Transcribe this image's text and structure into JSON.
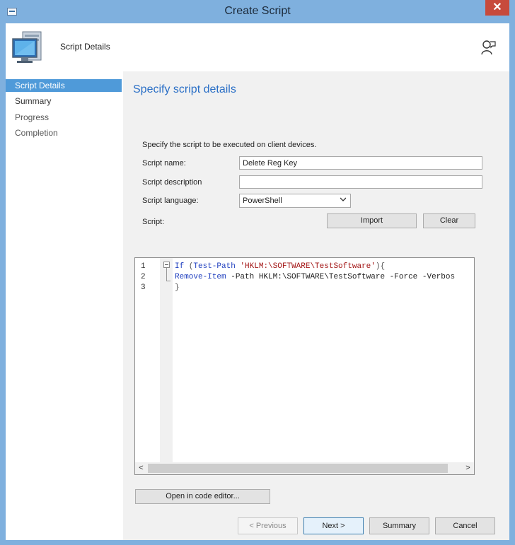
{
  "window": {
    "title": "Create Script",
    "close_label": "✕"
  },
  "header": {
    "title": "Script Details"
  },
  "nav": {
    "items": [
      {
        "label": "Script Details"
      },
      {
        "label": "Summary"
      },
      {
        "label": "Progress"
      },
      {
        "label": "Completion"
      }
    ]
  },
  "main": {
    "heading": "Specify script details",
    "instruction": "Specify the script to be executed on client devices.",
    "script_name_label": "Script name:",
    "script_name_value": "Delete Reg Key",
    "script_description_label": "Script description",
    "script_description_value": "",
    "script_language_label": "Script language:",
    "script_language_value": "PowerShell",
    "script_label": "Script:",
    "import_label": "Import",
    "clear_label": "Clear",
    "editor": {
      "line_numbers": [
        "1",
        "2",
        "3"
      ],
      "line1": {
        "kw": "If",
        "p1": " (",
        "fn": "Test-Path",
        "sp": " ",
        "str": "'HKLM:\\SOFTWARE\\TestSoftware'",
        "p2": "){"
      },
      "line2": {
        "cmd": "Remove-Item",
        "rest": " -Path HKLM:\\SOFTWARE\\TestSoftware -Force -Verbos"
      },
      "line3": "}",
      "scroll_left": "<",
      "scroll_right": ">"
    },
    "open_editor_label": "Open in code editor..."
  },
  "footer": {
    "previous_label": "< Previous",
    "next_label": "Next >",
    "summary_label": "Summary",
    "cancel_label": "Cancel"
  }
}
